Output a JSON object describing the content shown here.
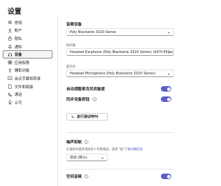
{
  "window": {
    "title": "设置"
  },
  "sidebar": {
    "items": [
      {
        "label": "常规",
        "icon": "gear-icon"
      },
      {
        "label": "帐户",
        "icon": "user-icon"
      },
      {
        "label": "隐私",
        "icon": "lock-icon"
      },
      {
        "label": "通知",
        "icon": "bell-icon"
      },
      {
        "label": "设备",
        "icon": "device-icon"
      },
      {
        "label": "应用权限",
        "icon": "grid-icon"
      },
      {
        "label": "辅助功能",
        "icon": "accessibility-icon"
      },
      {
        "label": "会议字幕和转录",
        "icon": "captions-icon"
      },
      {
        "label": "文件和链接",
        "icon": "file-icon"
      },
      {
        "label": "通话",
        "icon": "phone-icon"
      },
      {
        "label": "认可",
        "icon": "badge-icon"
      }
    ],
    "active_index": 4
  },
  "main": {
    "audio_device": {
      "title": "音频设备",
      "value": "Poly Blackwire 3320 Series"
    },
    "speaker": {
      "label": "扬声器",
      "value": "Headset Earphone (Poly Blackwire 3320 Series) (047f:430a)"
    },
    "microphone": {
      "label": "麦克风",
      "value": "Headset Microphone (Poly Blackwire 3320 Series)"
    },
    "auto_adjust": {
      "label": "自动调整麦克风灵敏度",
      "on": true
    },
    "sync_buttons": {
      "label": "同步设备按钮",
      "on": true
    },
    "test_call_button": "进行测试呼叫",
    "noise_suppression": {
      "title": "噪声抑制",
      "description": "在通话中选择消除多少背景噪音。选择 \"低\"",
      "link": "了解详细信息",
      "value": "自动 (默认)"
    },
    "spatial_audio": {
      "label": "空间音频",
      "on": true
    }
  },
  "colors": {
    "accent": "#5b5fc7",
    "toggle_on": "#5b5fc7"
  }
}
